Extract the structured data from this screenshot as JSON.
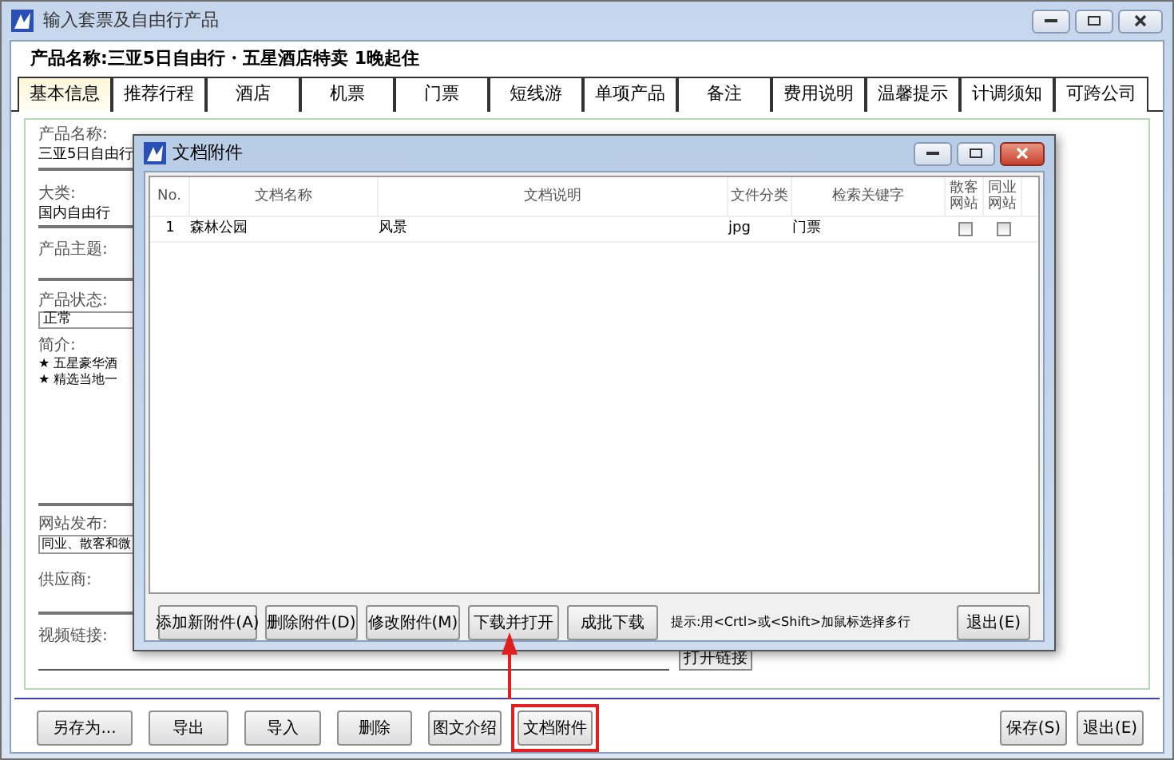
{
  "window": {
    "title": "输入套票及自由行产品"
  },
  "product_title": "产品名称:三亚5日自由行・五星酒店特卖 1晚起住",
  "tabs": [
    {
      "label": "基本信息",
      "selected": true
    },
    {
      "label": "推荐行程",
      "selected": false
    },
    {
      "label": "酒店",
      "selected": false
    },
    {
      "label": "机票",
      "selected": false
    },
    {
      "label": "门票",
      "selected": false
    },
    {
      "label": "短线游",
      "selected": false
    },
    {
      "label": "单项产品",
      "selected": false
    },
    {
      "label": "备注",
      "selected": false
    },
    {
      "label": "费用说明",
      "selected": false
    },
    {
      "label": "温馨提示",
      "selected": false
    },
    {
      "label": "计调须知",
      "selected": false
    },
    {
      "label": "可跨公司",
      "selected": false
    }
  ],
  "form": {
    "name_label": "产品名称:",
    "name_value": "三亚5日自由行",
    "category_label": "大类:",
    "category_value": "国内自由行",
    "theme_label": "产品主题:",
    "status_label": "产品状态:",
    "status_value": "正常",
    "intro_label": "简介:",
    "intro_lines": [
      "★ 五星豪华酒",
      "★ 精选当地一"
    ],
    "publish_label": "网站发布:",
    "publish_value": "同业、散客和微",
    "supplier_label": "供应商:",
    "video_label": "视频链接:",
    "open_link_button": "打开链接"
  },
  "toolbar": {
    "left": [
      {
        "label": "另存为...",
        "highlighted": false
      },
      {
        "label": "导出",
        "highlighted": false
      },
      {
        "label": "导入",
        "highlighted": false
      },
      {
        "label": "删除",
        "highlighted": false
      },
      {
        "label": "图文介绍",
        "highlighted": false
      },
      {
        "label": "文档附件",
        "highlighted": true
      }
    ],
    "right": [
      "保存(S)",
      "退出(E)"
    ]
  },
  "dialog": {
    "title": "文档附件",
    "columns": [
      "No.",
      "文档名称",
      "文档说明",
      "文件分类",
      "检索关键字",
      "散客网站",
      "同业网站"
    ],
    "rows": [
      {
        "no": "1",
        "name": "森林公园",
        "description": "风景",
        "type": "jpg",
        "keywords": "门票",
        "retail_site": false,
        "trade_site": false
      }
    ],
    "buttons": [
      "添加新附件(A)",
      "删除附件(D)",
      "修改附件(M)",
      "下载并打开",
      "成批下载"
    ],
    "hint": "提示:用<Crtl>或<Shift>加鼠标选择多行",
    "exit_button": "退出(E)"
  }
}
